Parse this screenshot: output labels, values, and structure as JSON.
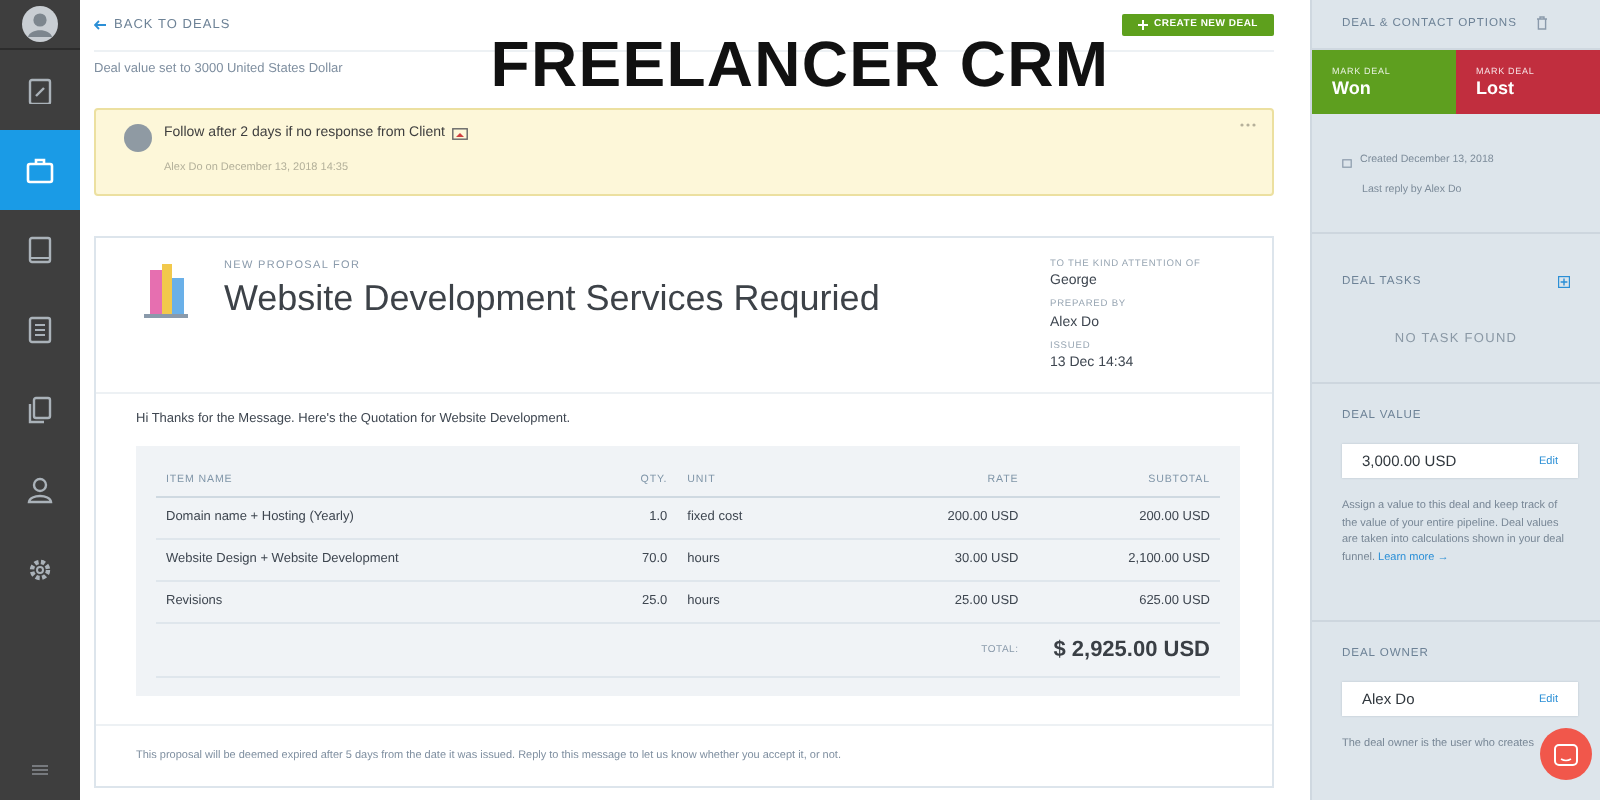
{
  "overlay_title": "FREELANCER CRM",
  "sidebar": {
    "items": [
      {
        "kind": "clipboard",
        "selected": false
      },
      {
        "kind": "briefcase",
        "selected": true
      },
      {
        "kind": "book",
        "selected": false
      },
      {
        "kind": "document",
        "selected": false
      },
      {
        "kind": "copies",
        "selected": false
      },
      {
        "kind": "person",
        "selected": false
      },
      {
        "kind": "gear",
        "selected": false
      }
    ]
  },
  "header": {
    "back_link": "BACK TO DEALS",
    "create_button": "CREATE NEW DEAL"
  },
  "activity": "Deal value set to 3000 United States Dollar",
  "note": {
    "text": "Follow after 2 days if no response from Client",
    "meta": "Alex Do on December 13, 2018 14:35"
  },
  "proposal": {
    "eyebrow": "NEW PROPOSAL FOR",
    "title": "Website Development Services Requried",
    "details": [
      {
        "label": "TO THE KIND ATTENTION OF",
        "value": "George"
      },
      {
        "label": "PREPARED BY",
        "value": "Alex Do"
      },
      {
        "label": "ISSUED",
        "value": "13 Dec 14:34"
      }
    ],
    "greeting": "Hi Thanks for the Message. Here's the Quotation for Website Development.",
    "table": {
      "columns": [
        "ITEM NAME",
        "QTY.",
        "UNIT",
        "RATE",
        "SUBTOTAL"
      ],
      "rows": [
        [
          "Domain name + Hosting (Yearly)",
          "1.0",
          "fixed cost",
          "200.00 USD",
          "200.00 USD"
        ],
        [
          "Website Design + Website Development",
          "70.0",
          "hours",
          "30.00 USD",
          "2,100.00 USD"
        ],
        [
          "Revisions",
          "25.0",
          "hours",
          "25.00 USD",
          "625.00 USD"
        ]
      ]
    },
    "total_label": "TOTAL:",
    "total": "$ 2,925.00 USD",
    "footer": "This proposal will be deemed expired after 5 days from the date it was issued. Reply to this message to let us know whether you accept it, or not."
  },
  "right_panel": {
    "title": "DEAL & CONTACT OPTIONS",
    "mark_buttons": [
      {
        "kind": "won",
        "label": "MARK DEAL",
        "value": "Won"
      },
      {
        "kind": "lost",
        "label": "MARK DEAL",
        "value": "Lost"
      }
    ],
    "created": "Created December 13, 2018",
    "last_reply": "Last reply by Alex Do",
    "tasks": {
      "title": "DEAL TASKS",
      "empty": "NO TASK FOUND"
    },
    "deal_value": {
      "title": "DEAL VALUE",
      "value": "3,000.00 USD",
      "edit": "Edit",
      "help": "Assign a value to this deal and keep track of the value of your entire pipeline. Deal values are taken into calculations shown in your deal funnel.",
      "link": "Learn more →"
    },
    "deal_owner": {
      "title": "DEAL OWNER",
      "value": "Alex Do",
      "edit": "Edit",
      "help": "The deal owner is the user who creates"
    }
  }
}
